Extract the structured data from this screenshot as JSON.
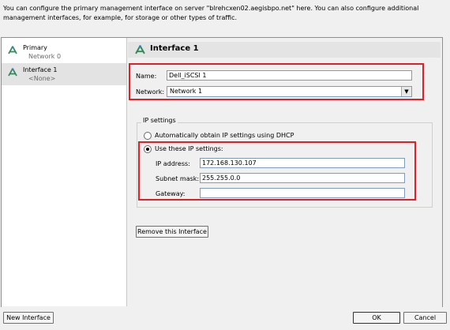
{
  "description": "You can configure the primary management interface on server \"blrehcxen02.aegisbpo.net\" here.  You can also configure additional management interfaces, for example, for storage or other types of traffic.",
  "sidebar": {
    "items": [
      {
        "title": "Primary",
        "subtitle": "Network 0",
        "icon": "network-interface-icon",
        "selected": false
      },
      {
        "title": "Interface 1",
        "subtitle": "<None>",
        "icon": "network-interface-icon",
        "selected": true
      }
    ]
  },
  "panel": {
    "title": "Interface 1",
    "name_label": "Name:",
    "name_value": "Dell_iSCSI 1",
    "network_label": "Network:",
    "network_value": "Network 1",
    "ip_settings": {
      "legend": "IP settings",
      "dhcp_label": "Automatically obtain IP settings using DHCP",
      "dhcp_selected": false,
      "static_label": "Use these IP settings:",
      "static_selected": true,
      "ip_label": "IP address:",
      "ip_value": "172.168.130.107",
      "subnet_label": "Subnet mask:",
      "subnet_value": "255.255.0.0",
      "gateway_label": "Gateway:",
      "gateway_value": ""
    },
    "remove_button": "Remove this Interface"
  },
  "footer": {
    "new_interface": "New Interface",
    "ok": "OK",
    "cancel": "Cancel"
  },
  "colors": {
    "highlight_box": "#e31e24",
    "selection": "#e3e3e3",
    "icon_green": "#2e8b57"
  }
}
